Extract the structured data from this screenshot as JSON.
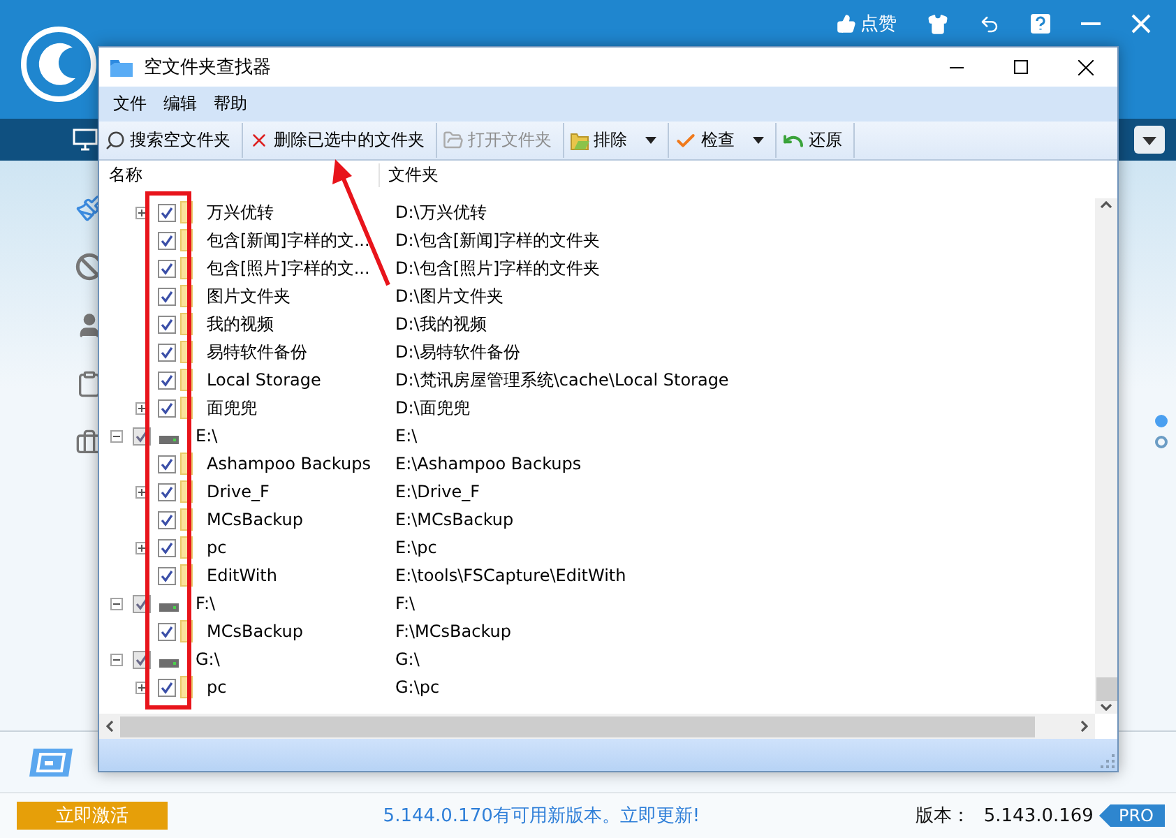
{
  "app": {
    "header_actions": [
      {
        "kind": "like",
        "label": "点赞"
      },
      {
        "kind": "shirt"
      },
      {
        "kind": "undo"
      },
      {
        "kind": "help"
      },
      {
        "kind": "minimize"
      },
      {
        "kind": "close"
      }
    ],
    "pager": [
      {
        "selected": true
      },
      {
        "selected": false
      }
    ],
    "status": {
      "activate_button": "立即激活",
      "update_notice": "5.144.0.170有可用新版本。立即更新!",
      "version_label": "版本：",
      "version": "5.143.0.169",
      "edition_badge": "PRO"
    }
  },
  "dialog": {
    "title": "空文件夹查找器",
    "menu": [
      "文件",
      "编辑",
      "帮助"
    ],
    "toolbar": [
      {
        "kind": "search",
        "label": "搜索空文件夹",
        "disabled": false,
        "dropdown": false
      },
      {
        "kind": "delete",
        "label": "删除已选中的文件夹",
        "disabled": false,
        "dropdown": false
      },
      {
        "kind": "open",
        "label": "打开文件夹",
        "disabled": true,
        "dropdown": false
      },
      {
        "kind": "exclude",
        "label": "排除",
        "disabled": false,
        "dropdown": true
      },
      {
        "kind": "check",
        "label": "检查",
        "disabled": false,
        "dropdown": true
      },
      {
        "kind": "restore",
        "label": "还原",
        "disabled": false,
        "dropdown": false
      }
    ],
    "columns": [
      "名称",
      "文件夹"
    ],
    "tree": [
      {
        "kind": "folder",
        "name": "万兴优转",
        "path": "D:\\万兴优转",
        "checked": true,
        "expanded": false
      },
      {
        "kind": "folder",
        "name": "包含[新闻]字样的文...",
        "path": "D:\\包含[新闻]字样的文件夹",
        "checked": true
      },
      {
        "kind": "folder",
        "name": "包含[照片]字样的文...",
        "path": "D:\\包含[照片]字样的文件夹",
        "checked": true
      },
      {
        "kind": "folder",
        "name": "图片文件夹",
        "path": "D:\\图片文件夹",
        "checked": true
      },
      {
        "kind": "folder",
        "name": "我的视频",
        "path": "D:\\我的视频",
        "checked": true
      },
      {
        "kind": "folder",
        "name": "易特软件备份",
        "path": "D:\\易特软件备份",
        "checked": true
      },
      {
        "kind": "folder",
        "name": "Local Storage",
        "path": "D:\\梵讯房屋管理系统\\cache\\Local Storage",
        "checked": true
      },
      {
        "kind": "folder",
        "name": "面兜兜",
        "path": "D:\\面兜兜",
        "checked": true,
        "expanded": false
      },
      {
        "kind": "drive",
        "name": "E:\\",
        "path": "E:\\",
        "checked": true,
        "expanded": true,
        "children": [
          {
            "kind": "folder",
            "name": "Ashampoo Backups",
            "path": "E:\\Ashampoo Backups",
            "checked": true
          },
          {
            "kind": "folder",
            "name": "Drive_F",
            "path": "E:\\Drive_F",
            "checked": true,
            "expanded": false
          },
          {
            "kind": "folder",
            "name": "MCsBackup",
            "path": "E:\\MCsBackup",
            "checked": true
          },
          {
            "kind": "folder",
            "name": "pc",
            "path": "E:\\pc",
            "checked": true,
            "expanded": false
          },
          {
            "kind": "folder",
            "name": "EditWith",
            "path": "E:\\tools\\FSCapture\\EditWith",
            "checked": true
          }
        ]
      },
      {
        "kind": "drive",
        "name": "F:\\",
        "path": "F:\\",
        "checked": true,
        "expanded": true,
        "children": [
          {
            "kind": "folder",
            "name": "MCsBackup",
            "path": "F:\\MCsBackup",
            "checked": true
          }
        ]
      },
      {
        "kind": "drive",
        "name": "G:\\",
        "path": "G:\\",
        "checked": true,
        "expanded": true,
        "children": [
          {
            "kind": "folder",
            "name": "pc",
            "path": "G:\\pc",
            "checked": true,
            "expanded": false
          }
        ]
      }
    ]
  }
}
